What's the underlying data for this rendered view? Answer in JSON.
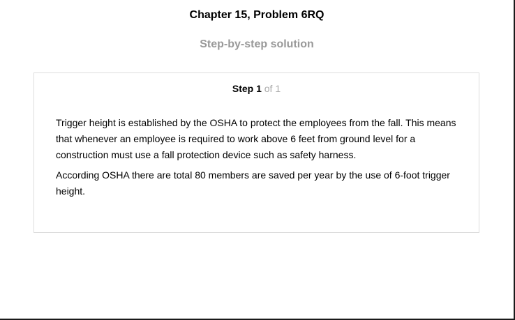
{
  "header": {
    "chapter_title": "Chapter 15, Problem 6RQ",
    "subtitle": "Step-by-step solution"
  },
  "step": {
    "label": "Step 1",
    "total": "of 1",
    "paragraphs": [
      "Trigger height is established by the OSHA to protect the employees from the fall. This means that whenever an employee is required to work above 6 feet from ground level for a construction must use a fall protection device such as safety harness.",
      "According OSHA there are total 80 members are saved per year by the use of 6-foot trigger height."
    ]
  },
  "colors": {
    "subtitle": "#999999",
    "step_total": "#aaaaaa",
    "card_border": "#dddddd"
  }
}
